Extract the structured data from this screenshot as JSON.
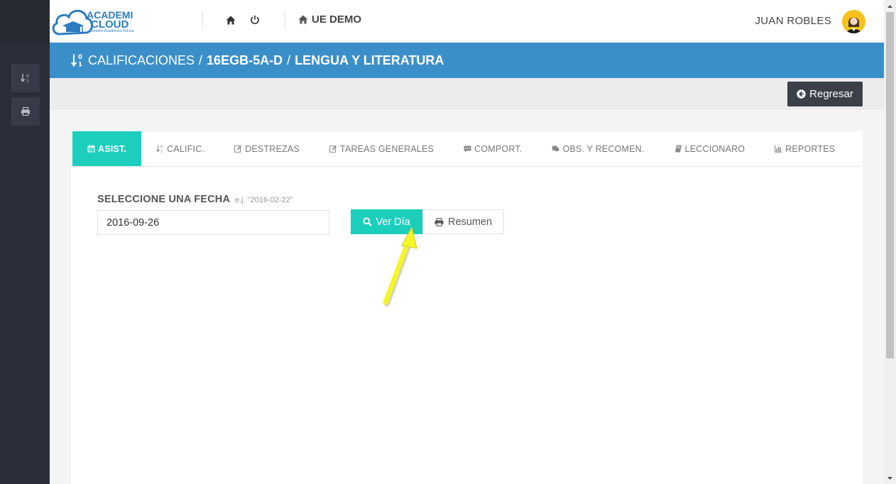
{
  "header": {
    "logo": {
      "line1": "ACADEMI",
      "line2": "CLOUD",
      "tagline": "Gestión Académica OnLine"
    },
    "org_name": "UE DEMO",
    "user_name": "JUAN ROBLES",
    "icons": [
      "home-icon",
      "power-icon",
      "home-small-icon"
    ]
  },
  "title": {
    "section": "CALIFICACIONES",
    "course": "16EGB-5A-D",
    "subject": "LENGUA Y LITERATURA",
    "separator": "/"
  },
  "actions": {
    "back_label": "Regresar"
  },
  "tabs": [
    {
      "label": "ASIST.",
      "icon": "calendar-icon",
      "active": true
    },
    {
      "label": "CALIFIC.",
      "icon": "sort-numeric-icon",
      "active": false
    },
    {
      "label": "DESTREZAS",
      "icon": "edit-icon",
      "active": false
    },
    {
      "label": "TAREAS GENERALES",
      "icon": "edit-icon",
      "active": false
    },
    {
      "label": "COMPORT.",
      "icon": "comment-icon",
      "active": false
    },
    {
      "label": "OBS. Y RECOMEN.",
      "icon": "comments-icon",
      "active": false
    },
    {
      "label": "LECCIONARO",
      "icon": "book-icon",
      "active": false
    },
    {
      "label": "REPORTES",
      "icon": "bar-chart-icon",
      "active": false
    }
  ],
  "form": {
    "label": "SELECCIONE UNA FECHA",
    "hint": "e.j. \"2016-02-22\"",
    "date_value": "2016-09-26",
    "view_day_label": "Ver Día",
    "summary_label": "Resumen"
  },
  "colors": {
    "accent": "#1ccfbd",
    "titlebar": "#3a8fc9",
    "sidebar": "#2a2e38",
    "dark_button": "#3a3f48",
    "arrow": "#f5f52a"
  }
}
